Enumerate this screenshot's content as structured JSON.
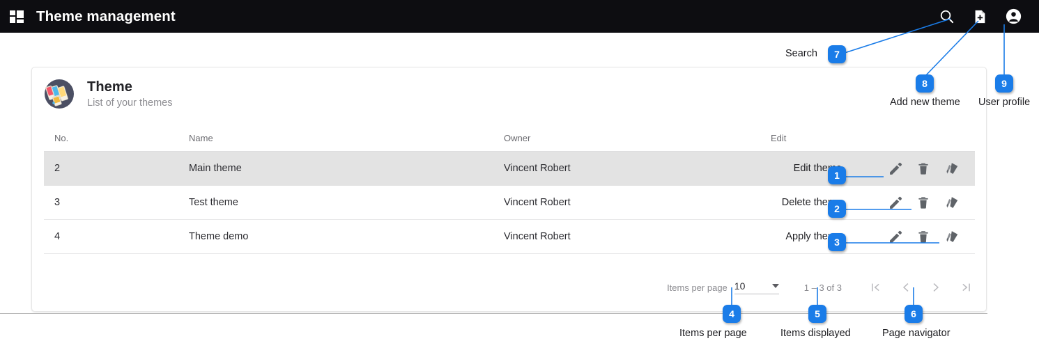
{
  "appbar": {
    "menu_icon": "dashboard-grid-icon",
    "title": "Theme management",
    "actions": [
      {
        "name": "search-icon",
        "label": "Search"
      },
      {
        "name": "add-new-theme-icon",
        "label": "Add new theme"
      },
      {
        "name": "user-profile-icon",
        "label": "User profile"
      }
    ]
  },
  "card": {
    "icon": "color-palette-icon",
    "title": "Theme",
    "subtitle": "List of your themes"
  },
  "table": {
    "headers": {
      "no": "No.",
      "name": "Name",
      "owner": "Owner",
      "edit": "Edit"
    },
    "rows": [
      {
        "no": "2",
        "name": "Main theme",
        "owner": "Vincent Robert",
        "action_label": "Edit theme",
        "selected": true
      },
      {
        "no": "3",
        "name": "Test theme",
        "owner": "Vincent Robert",
        "action_label": "Delete theme",
        "selected": false
      },
      {
        "no": "4",
        "name": "Theme demo",
        "owner": "Vincent Robert",
        "action_label": "Apply theme",
        "selected": false
      }
    ],
    "row_icons": [
      "edit-pencil-icon",
      "delete-trash-icon",
      "apply-paint-roller-icon"
    ]
  },
  "paginator": {
    "items_per_page_label": "Items per page",
    "items_per_page_value": "10",
    "range_label": "1 – 3 of 3",
    "nav": {
      "first": "first-page-icon",
      "previous": "previous-page-icon",
      "next": "next-page-icon",
      "last": "last-page-icon"
    }
  },
  "annotations": [
    {
      "number": "1",
      "label": "Edit theme"
    },
    {
      "number": "2",
      "label": "Delete theme"
    },
    {
      "number": "3",
      "label": "Apply theme"
    },
    {
      "number": "4",
      "label": "Items per page"
    },
    {
      "number": "5",
      "label": "Items displayed"
    },
    {
      "number": "6",
      "label": "Page navigator"
    },
    {
      "number": "7",
      "label": "Search"
    },
    {
      "number": "8",
      "label": "Add new theme"
    },
    {
      "number": "9",
      "label": "User profile"
    }
  ],
  "colors": {
    "appbar_bg": "#0d0d11",
    "badge_blue": "#1a7ce8",
    "selected_row": "#e3e3e3",
    "icon_gray": "#5f6368"
  }
}
